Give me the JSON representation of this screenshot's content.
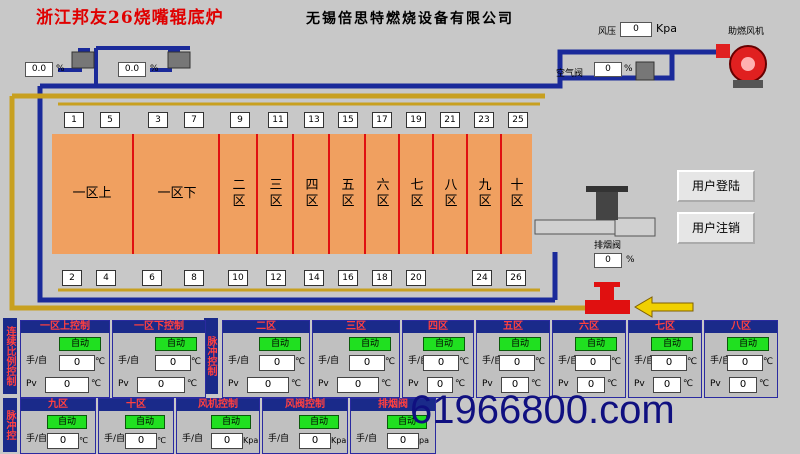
{
  "header": {
    "title_left": "浙江邦友26烧嘴辊底炉",
    "title_right": "无锡倍思特燃烧设备有限公司"
  },
  "top_controls": {
    "valve1_value": "0.0",
    "valve2_value": "0.0",
    "pct_unit": "%",
    "wind_pressure_label": "风压",
    "wind_pressure_value": "0",
    "wind_pressure_unit": "Kpa",
    "air_valve_label": "空气阀",
    "air_valve_value": "0",
    "fan_label": "助燃风机"
  },
  "furnace": {
    "zones": [
      "一区上",
      "一区下",
      "二\n区",
      "三\n区",
      "四\n区",
      "五\n区",
      "六\n区",
      "七\n区",
      "八\n区",
      "九\n区",
      "十\n区"
    ],
    "top_burners": [
      "1",
      "5",
      "3",
      "7",
      "9",
      "11",
      "13",
      "15",
      "17",
      "19",
      "21",
      "23",
      "25"
    ],
    "bottom_burners": [
      "2",
      "4",
      "6",
      "8",
      "10",
      "12",
      "14",
      "16",
      "18",
      "20",
      "24",
      "26"
    ]
  },
  "exhaust": {
    "label": "排烟阀",
    "value": "0",
    "unit": "%"
  },
  "buttons": {
    "login": "用户登陆",
    "logout": "用户注销"
  },
  "side_labels": {
    "left_top": "连续比例控制",
    "left_bottom": "脉冲控",
    "mid": "脉冲控制"
  },
  "panels_row1": [
    {
      "title": "一区上控制",
      "mode": "手/自",
      "auto": "自动",
      "value": "0",
      "pv_label": "Pv",
      "pv": "0",
      "unit": "℃"
    },
    {
      "title": "一区下控制",
      "mode": "手/自",
      "auto": "自动",
      "value": "0",
      "pv_label": "Pv",
      "pv": "0",
      "unit": "℃"
    },
    {
      "title": "二区",
      "mode": "手/自",
      "auto": "自动",
      "value": "0",
      "pv_label": "Pv",
      "pv": "0",
      "unit": "℃"
    },
    {
      "title": "三区",
      "mode": "手/自",
      "auto": "自动",
      "value": "0",
      "pv_label": "Pv",
      "pv": "0",
      "unit": "℃"
    },
    {
      "title": "四区",
      "mode": "手/自",
      "auto": "自动",
      "value": "0",
      "pv_label": "Pv",
      "pv": "0",
      "unit": "℃"
    },
    {
      "title": "五区",
      "mode": "手/自",
      "auto": "自动",
      "value": "0",
      "pv_label": "Pv",
      "pv": "0",
      "unit": "℃"
    },
    {
      "title": "六区",
      "mode": "手/自",
      "auto": "自动",
      "value": "0",
      "pv_label": "Pv",
      "pv": "0",
      "unit": "℃"
    },
    {
      "title": "七区",
      "mode": "手/自",
      "auto": "自动",
      "value": "0",
      "pv_label": "Pv",
      "pv": "0",
      "unit": "℃"
    },
    {
      "title": "八区",
      "mode": "手/自",
      "auto": "自动",
      "value": "0",
      "pv_label": "Pv",
      "pv": "0",
      "unit": "℃"
    }
  ],
  "panels_row2": [
    {
      "title": "九区",
      "mode": "手/自",
      "auto": "自动",
      "value": "0",
      "unit": "℃"
    },
    {
      "title": "十区",
      "mode": "手/自",
      "auto": "自动",
      "value": "0",
      "unit": "℃"
    },
    {
      "title": "风机控制",
      "mode": "手/自",
      "auto": "自动",
      "value": "0",
      "unit": "Kpa"
    },
    {
      "title": "风阀控制",
      "mode": "手/自",
      "auto": "自动",
      "value": "0",
      "unit": "Kpa"
    },
    {
      "title": "排烟阀",
      "mode": "手/自",
      "auto": "自动",
      "value": "0",
      "unit": "pa"
    }
  ],
  "watermark": "61966800.com",
  "colors": {
    "pipe_blue": "#1a2a9a",
    "pipe_gold": "#c8a020",
    "zone_fill": "#f0a060",
    "zone_divider": "#e01010",
    "panel_header": "#1a2a8a",
    "auto_green": "#20e020"
  }
}
